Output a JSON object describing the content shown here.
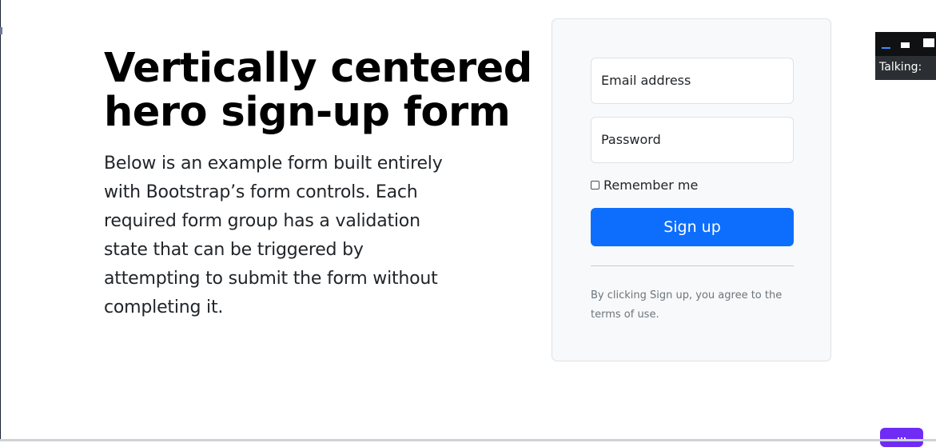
{
  "hero": {
    "title": "Vertically centered hero sign-up form",
    "lead": "Below is an example form built entirely with Bootstrap’s form controls. Each required form group has a validation state that can be triggered by attempting to submit the form without completing it."
  },
  "form": {
    "email_label": "Email address",
    "password_label": "Password",
    "remember_label": "Remember me",
    "remember_checked": false,
    "submit_label": "Sign up",
    "terms_text": "By clicking Sign up, you agree to the terms of use."
  },
  "widget": {
    "talking_label": "Talking:"
  },
  "colors": {
    "primary": "#0d6efd",
    "card_background": "#f8f9fa",
    "card_border": "#dee2e6",
    "muted_text": "#6c757d",
    "widget_background": "#2b2f33",
    "widget_accent": "#6f2cf5"
  },
  "icons": {
    "checkbox": "checkbox-icon",
    "widget_controls": [
      "minimize-icon",
      "stop-icon",
      "window-icon"
    ]
  }
}
